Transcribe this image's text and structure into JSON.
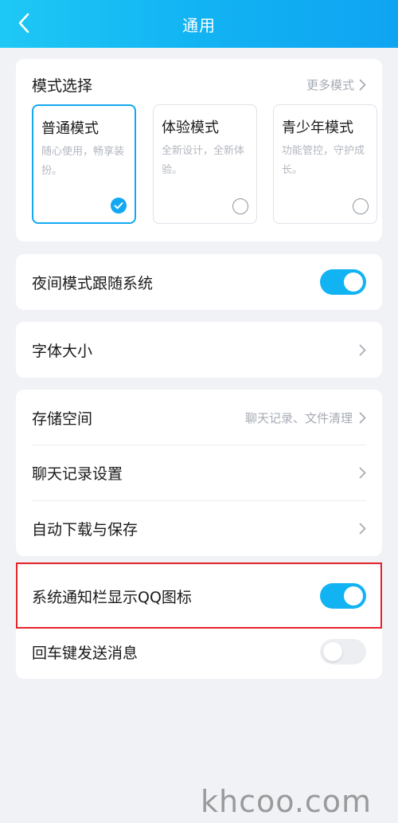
{
  "header": {
    "title": "通用"
  },
  "mode_section": {
    "title": "模式选择",
    "more_label": "更多模式",
    "modes": [
      {
        "name": "普通模式",
        "desc": "随心使用，畅享装扮。",
        "selected": true
      },
      {
        "name": "体验模式",
        "desc": "全新设计，全新体验。",
        "selected": false
      },
      {
        "name": "青少年模式",
        "desc": "功能管控，守护成长。",
        "selected": false
      }
    ]
  },
  "night_mode": {
    "label": "夜间模式跟随系统",
    "enabled": true
  },
  "font_size": {
    "label": "字体大小"
  },
  "storage": {
    "label": "存储空间",
    "value": "聊天记录、文件清理"
  },
  "chat_history": {
    "label": "聊天记录设置"
  },
  "auto_download": {
    "label": "自动下载与保存"
  },
  "notif_icon": {
    "label": "系统通知栏显示QQ图标",
    "enabled": true
  },
  "enter_send": {
    "label": "回车键发送消息",
    "enabled": false
  },
  "watermark": "khcoo.com",
  "colors": {
    "accent": "#12b3f3",
    "highlight": "#e5232a",
    "background": "#f0f2f6"
  }
}
